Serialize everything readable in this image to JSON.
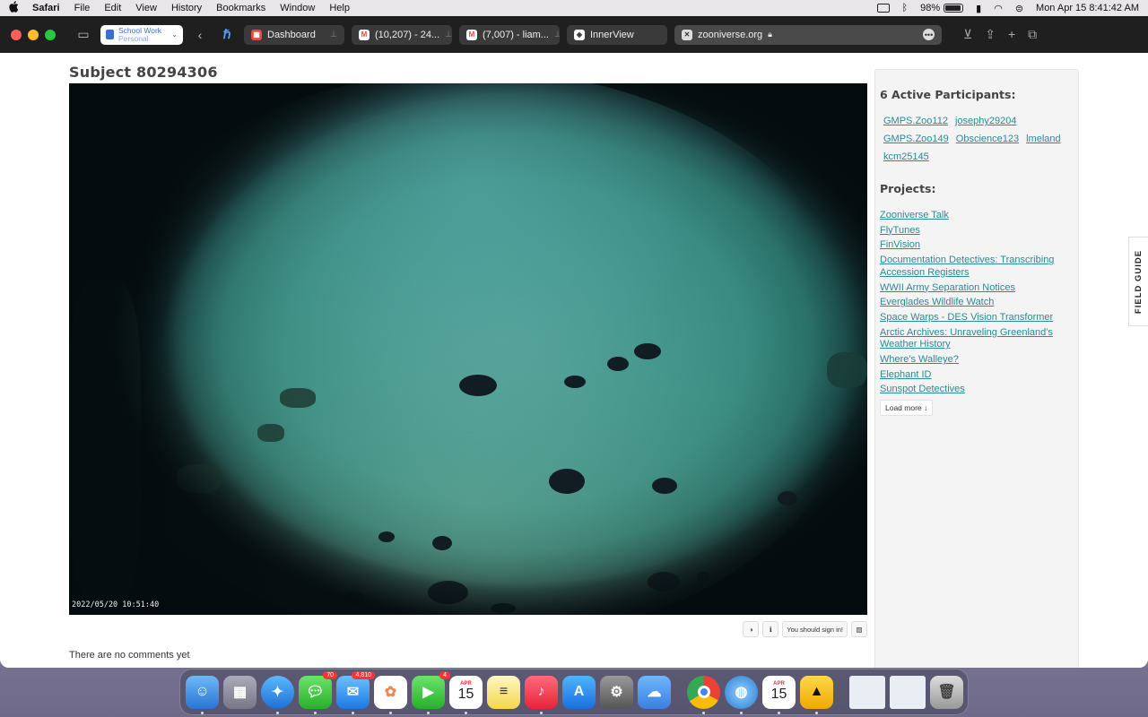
{
  "menubar": {
    "app": "Safari",
    "items": [
      "File",
      "Edit",
      "View",
      "History",
      "Bookmarks",
      "Window",
      "Help"
    ],
    "battery": "98%",
    "clock": "Mon Apr 15  8:41:42 AM"
  },
  "browser": {
    "profile": {
      "name": "School Work",
      "sub": "Personal"
    },
    "tabs": [
      {
        "label": "Dashboard",
        "icon": "dashboard-favicon"
      },
      {
        "label": "(10,207) - 24...",
        "icon": "gmail-favicon"
      },
      {
        "label": "(7,007) - liam...",
        "icon": "gmail-favicon"
      },
      {
        "label": "InnerView",
        "icon": "innerview-favicon"
      }
    ],
    "address": "zooniverse.org"
  },
  "page": {
    "subject_title": "Subject 80294306",
    "image_timestamp": "2022/05/20 10:51:40",
    "tool_signin": "You should sign in!",
    "comments_text": "There are no comments yet"
  },
  "sidebar": {
    "participants_heading": "6 Active Participants:",
    "participants": [
      "GMPS.Zoo112",
      "josephy29204",
      "GMPS.Zoo149",
      "Obscience123",
      "lmeland",
      "kcm25145"
    ],
    "projects_heading": "Projects:",
    "projects": [
      "Zooniverse Talk",
      "FlyTunes",
      "FinVision",
      "Documentation Detectives: Transcribing Accession Registers",
      "WWII Army Separation Notices",
      "Everglades Wildlife Watch",
      "Space Warps - DES Vision Transformer",
      "Arctic Archives: Unraveling Greenland's Weather History",
      "Where's Walleye?",
      "Elephant ID",
      "Sunspot Detectives"
    ],
    "load_more": "Load more",
    "field_guide": "FIELD GUIDE"
  },
  "dock": {
    "messages_badge": "70",
    "mail_badge": "4,810",
    "facetime_badge": "4",
    "calendar_month": "APR",
    "calendar_day": "15"
  },
  "colors": {
    "link": "#2a8a95",
    "water": "#3f948d",
    "toolbar": "#1f1f1f"
  }
}
